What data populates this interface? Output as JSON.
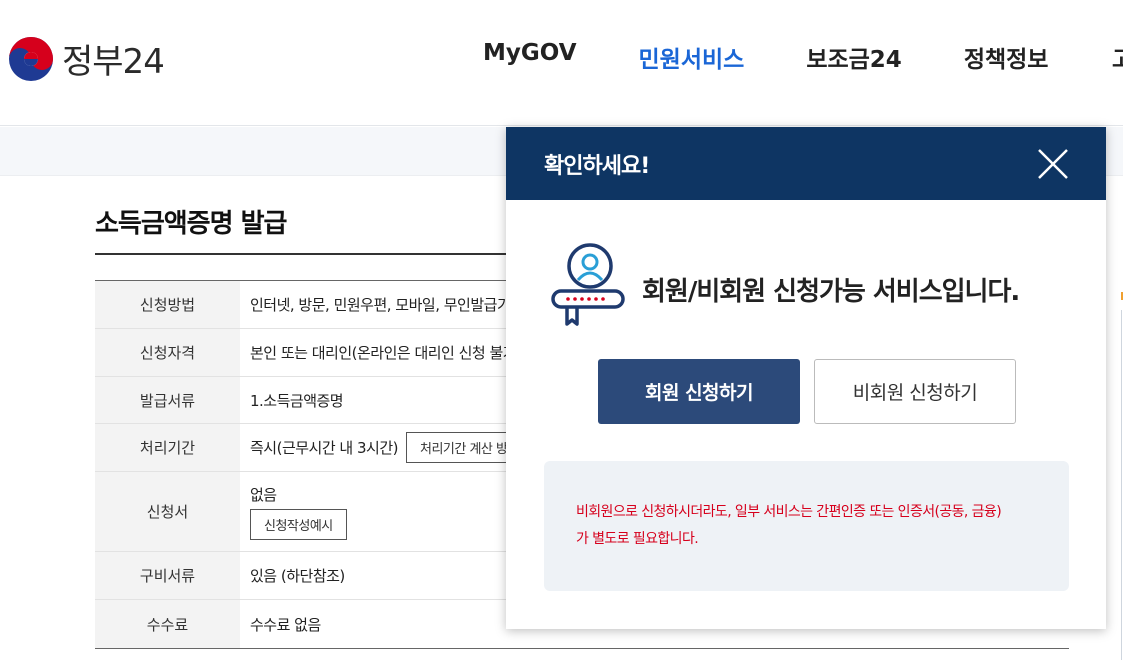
{
  "header": {
    "logo_text": "정부24",
    "nav": [
      "MyGOV",
      "민원서비스",
      "보조금24",
      "정책정보"
    ],
    "nav_active_index": 1,
    "nav_cut_text": "고"
  },
  "page": {
    "title": "소득금액증명 발급",
    "rows": [
      {
        "label": "신청방법",
        "value": "인터넷, 방문, 민원우편, 모바일, 무인발급기"
      },
      {
        "label": "신청자격",
        "value": "본인 또는 대리인(온라인은 대리인 신청 불가)"
      },
      {
        "label": "발급서류",
        "value": "1.소득금액증명"
      },
      {
        "label": "처리기간",
        "value": "즉시(근무시간 내 3시간)",
        "button": "처리기간 계산 방법"
      },
      {
        "label": "신청서",
        "value": "없음",
        "button": "신청작성예시"
      },
      {
        "label": "구비서류",
        "value": "있음 (하단참조)"
      },
      {
        "label": "수수료",
        "value": "수수료 없음"
      }
    ]
  },
  "modal": {
    "title": "확인하세요!",
    "service_text": "회원/비회원 신청가능 서비스입니다.",
    "member_button": "회원 신청하기",
    "nonmember_button": "비회원 신청하기",
    "notice_line1": "비회원으로 신청하시더라도, 일부 서비스는 간편인증 또는 인증서(공동, 금융)",
    "notice_line2": "가 별도로 필요합니다."
  },
  "colors": {
    "modal_header": "#0e3563",
    "primary_button": "#2c4a7a",
    "nav_active": "#1a66d6",
    "notice_text": "#d6001c"
  }
}
